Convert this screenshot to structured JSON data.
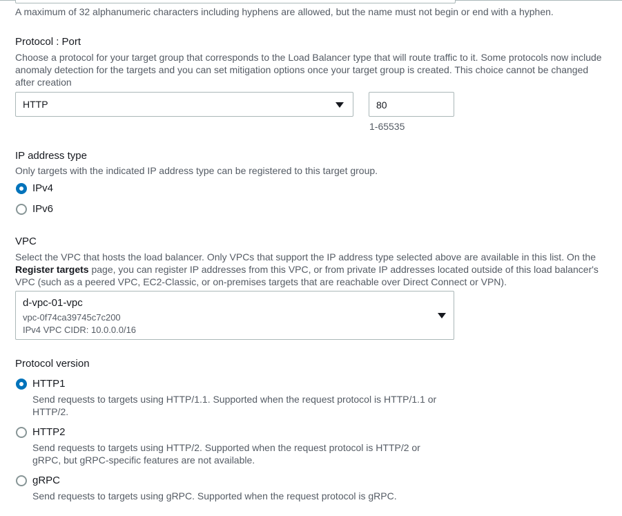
{
  "name_field": {
    "hint": "A maximum of 32 alphanumeric characters including hyphens are allowed, but the name must not begin or end with a hyphen."
  },
  "protocol_port": {
    "label": "Protocol : Port",
    "description": "Choose a protocol for your target group that corresponds to the Load Balancer type that will route traffic to it. Some protocols now include anomaly detection for the targets and you can set mitigation options once your target group is created. This choice cannot be changed after creation",
    "protocol_value": "HTTP",
    "port_value": "80",
    "port_hint": "1-65535"
  },
  "ip_address_type": {
    "label": "IP address type",
    "description": "Only targets with the indicated IP address type can be registered to this target group.",
    "options": [
      {
        "label": "IPv4",
        "selected": true
      },
      {
        "label": "IPv6",
        "selected": false
      }
    ]
  },
  "vpc": {
    "label": "VPC",
    "description_part1": "Select the VPC that hosts the load balancer. Only VPCs that support the IP address type selected above are available in this list. On the ",
    "description_bold": "Register targets",
    "description_part2": " page, you can register IP addresses from this VPC, or from private IP addresses located outside of this load balancer's VPC (such as a peered VPC, EC2-Classic, or on-premises targets that are reachable over Direct Connect or VPN).",
    "selected_name": "d-vpc-01-vpc",
    "selected_id": "vpc-0f74ca39745c7c200",
    "selected_cidr": "IPv4 VPC CIDR: 10.0.0.0/16"
  },
  "protocol_version": {
    "label": "Protocol version",
    "options": [
      {
        "label": "HTTP1",
        "selected": true,
        "description": "Send requests to targets using HTTP/1.1. Supported when the request protocol is HTTP/1.1 or HTTP/2."
      },
      {
        "label": "HTTP2",
        "selected": false,
        "description": "Send requests to targets using HTTP/2. Supported when the request protocol is HTTP/2 or gRPC, but gRPC-specific features are not available."
      },
      {
        "label": "gRPC",
        "selected": false,
        "description": "Send requests to targets using gRPC. Supported when the request protocol is gRPC."
      }
    ]
  },
  "colors": {
    "accent": "#0073bb",
    "text": "#16191f",
    "secondary_text": "#545b64",
    "border": "#aab7b8"
  }
}
